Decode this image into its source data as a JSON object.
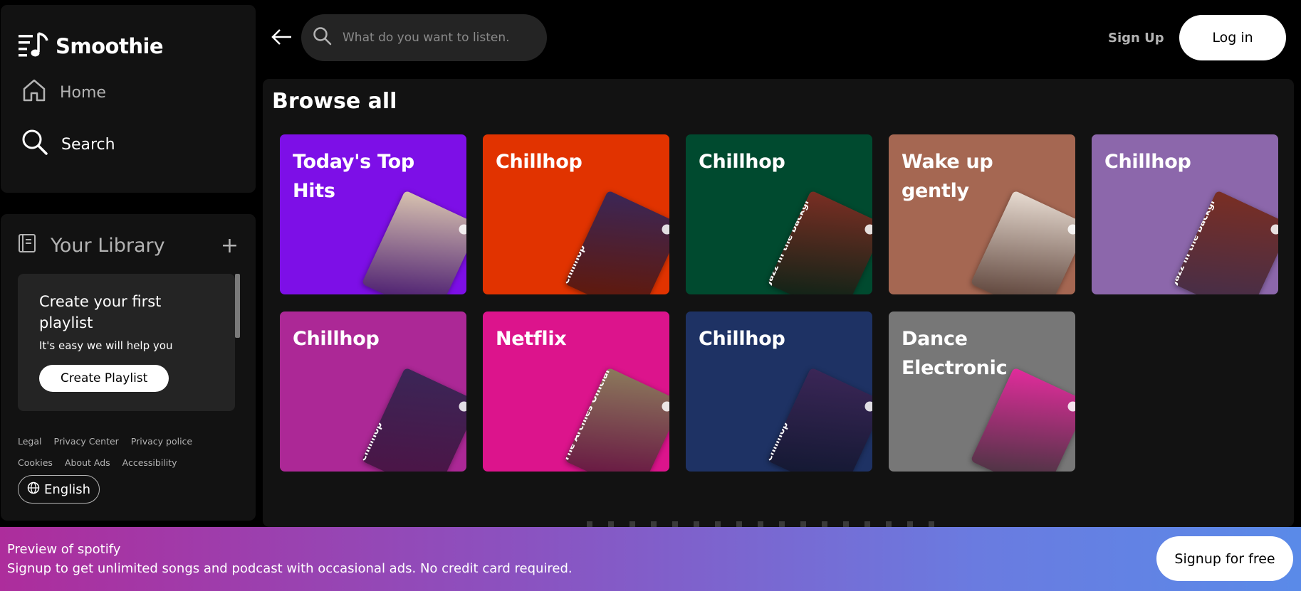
{
  "brand": {
    "name": "Smoothie"
  },
  "nav": {
    "home_label": "Home",
    "search_label": "Search"
  },
  "library": {
    "title": "Your Library",
    "create_title": "Create your first playlist",
    "create_sub": "It's easy we will help you",
    "create_button": "Create Playlist",
    "legal_links": [
      "Legal",
      "Privacy Center",
      "Privacy police",
      "Cookies",
      "About Ads",
      "Accessibility"
    ],
    "language": "English"
  },
  "topbar": {
    "search_placeholder": "What do you want to listen.",
    "signup_label": "Sign Up",
    "login_label": "Log in"
  },
  "main": {
    "title": "Browse all",
    "cards": [
      {
        "title": "Today's Top Hits",
        "color": "#7d0fe7",
        "art": "#d9c4b0",
        "art_text": ""
      },
      {
        "title": "Chillhop",
        "color": "#e13300",
        "art": "#3b2657",
        "art_text": "Chillhop"
      },
      {
        "title": "Chillhop",
        "color": "#004a2f",
        "art": "#7a2e23",
        "art_text": "Jazz in the Backgr"
      },
      {
        "title": "Wake up gently",
        "color": "#a56752",
        "art": "#e8dcd2",
        "art_text": ""
      },
      {
        "title": "Chillhop",
        "color": "#8c67ab",
        "art": "#7a2e23",
        "art_text": "Jazz in the Backgr"
      },
      {
        "title": "Chillhop",
        "color": "#ac2896",
        "art": "#3b2657",
        "art_text": "Chillhop"
      },
      {
        "title": "Netflix",
        "color": "#dc148c",
        "art": "#8c7a5c",
        "art_text": "The Archies Official Playl"
      },
      {
        "title": "Chillhop",
        "color": "#1e3264",
        "art": "#3b2657",
        "art_text": "Chillhop"
      },
      {
        "title": "Dance Electronic",
        "color": "#777777",
        "art": "#e22c9c",
        "art_text": ""
      }
    ]
  },
  "banner": {
    "title": "Preview of spotify",
    "subtitle": "Signup to get unlimited songs and podcast with occasional ads. No credit card required.",
    "button": "Signup for free"
  }
}
